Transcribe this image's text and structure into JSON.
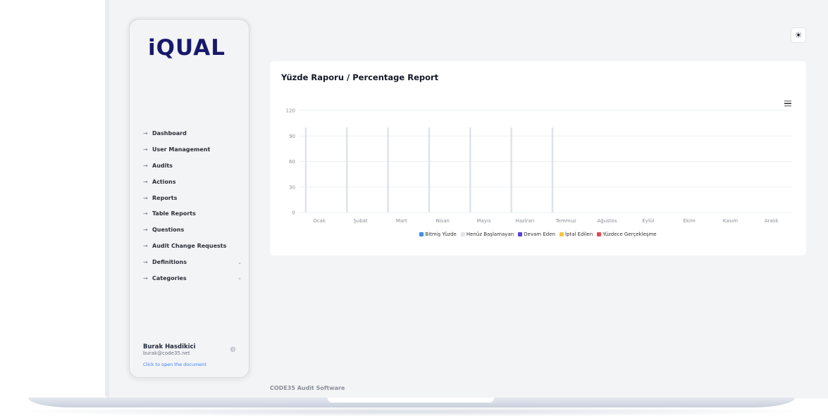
{
  "sidebar": {
    "logo": "iQUAL",
    "items": [
      {
        "label": "Dashboard",
        "active": true
      },
      {
        "label": "User Management"
      },
      {
        "label": "Audits"
      },
      {
        "label": "Actions"
      },
      {
        "label": "Reports"
      },
      {
        "label": "Table Reports"
      },
      {
        "label": "Questions"
      },
      {
        "label": "Audit Change Requests"
      },
      {
        "label": "Definitions",
        "expandable": true
      },
      {
        "label": "Categories",
        "expandable": true
      }
    ],
    "user": {
      "name": "Burak Hasdikici",
      "email": "burak@code35.net",
      "link": "Click to open the document"
    }
  },
  "icons": {
    "theme": "sun-icon",
    "nav": "arrow-right-icon",
    "expand": "chevron-down-icon",
    "settings": "gear-icon",
    "menu": "hamburger-menu-icon"
  },
  "card": {
    "title": "Yüzde Raporu / Percentage Report"
  },
  "footer": "CODE35 Audit Software",
  "colors": {
    "accent": "#3b82f6",
    "logo": "#18196b"
  },
  "chart_data": {
    "type": "bar",
    "categories": [
      "Ocak",
      "Şubat",
      "Mart",
      "Nisan",
      "Mayıs",
      "Haziran",
      "Temmuz",
      "Ağustos",
      "Eylül",
      "Ekim",
      "Kasım",
      "Aralık"
    ],
    "series": [
      {
        "name": "Bitmiş Yüzde",
        "color": "#3b8fe6",
        "values": [
          0,
          0,
          0,
          0,
          0,
          0,
          0,
          0,
          0,
          0,
          0,
          0
        ]
      },
      {
        "name": "Henüz Başlamayan",
        "color": "#dfe3ea",
        "values": [
          100,
          100,
          100,
          100,
          100,
          100,
          100,
          0,
          0,
          0,
          0,
          0
        ]
      },
      {
        "name": "Devam Eden",
        "color": "#5b3fd6",
        "values": [
          0,
          0,
          0,
          0,
          0,
          0,
          0,
          0,
          0,
          0,
          0,
          0
        ]
      },
      {
        "name": "İptal Edilen",
        "color": "#f5c542",
        "values": [
          0,
          0,
          0,
          0,
          0,
          0,
          0,
          0,
          0,
          0,
          0,
          0
        ]
      },
      {
        "name": "Yüzdece Gerçekleşme",
        "color": "#e5484d",
        "values": [
          0,
          0,
          0,
          0,
          0,
          0,
          0,
          0,
          0,
          0,
          0,
          0
        ]
      }
    ],
    "yticks": [
      0,
      30,
      60,
      90,
      120
    ],
    "ylim": [
      0,
      120
    ],
    "grid": true,
    "legend": "bottom-center"
  }
}
